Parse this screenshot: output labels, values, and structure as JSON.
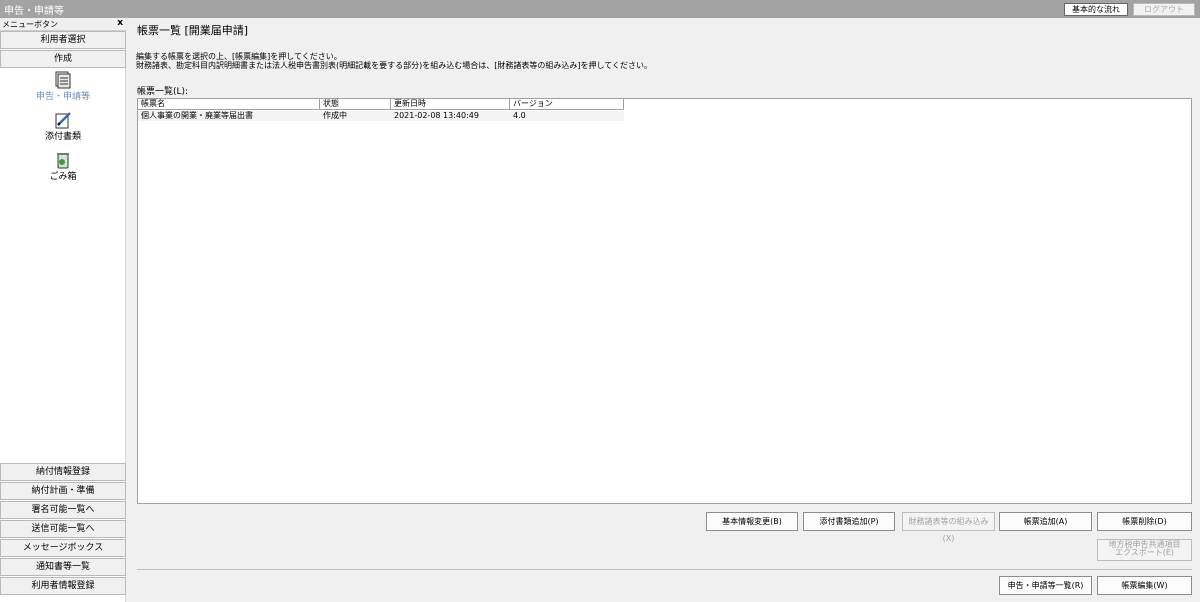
{
  "window": {
    "title": "申告・申請等"
  },
  "header": {
    "flow_button": "基本的な流れ",
    "logout_button": "ログアウト"
  },
  "sidebar": {
    "menu_label": "メニューボタン",
    "close_glyph": "x",
    "top_buttons": [
      "利用者選択",
      "作成"
    ],
    "icons": [
      {
        "label": "申告・申請等",
        "icon": "document-stack-icon"
      },
      {
        "label": "添付書類",
        "icon": "pen-document-icon"
      },
      {
        "label": "ごみ箱",
        "icon": "trash-icon"
      }
    ],
    "bottom_buttons": [
      "納付情報登録",
      "納付計画・準備",
      "署名可能一覧へ",
      "送信可能一覧へ",
      "メッセージボックス",
      "通知書等一覧",
      "利用者情報登録"
    ]
  },
  "main": {
    "title": "帳票一覧 [開業届申請]",
    "instruction_1": "編集する帳票を選択の上、[帳票編集]を押してください。",
    "instruction_2": "財務諸表、勘定科目内訳明細書または法人税申告書別表(明細記載を要する部分)を組み込む場合は、[財務諸表等の組み込み]を押してください。",
    "list_label": "帳票一覧(L):",
    "columns": [
      "帳票名",
      "状態",
      "更新日時",
      "バージョン"
    ],
    "rows": [
      {
        "name": "個人事業の開業・廃業等届出書",
        "status": "作成中",
        "updated": "2021-02-08 13:40:49",
        "version": "4.0"
      }
    ],
    "buttons": {
      "basic_info": "基本情報変更(B)",
      "attach": "添付書類追加(P)",
      "financial": "財務諸表等の組み込み(X)",
      "add": "帳票追加(A)",
      "delete": "帳票削除(D)",
      "export_line1": "地方税申告共通項目",
      "export_line2": "エクスポート(E)",
      "declaration_list": "申告・申請等一覧(R)",
      "edit": "帳票編集(W)"
    }
  }
}
